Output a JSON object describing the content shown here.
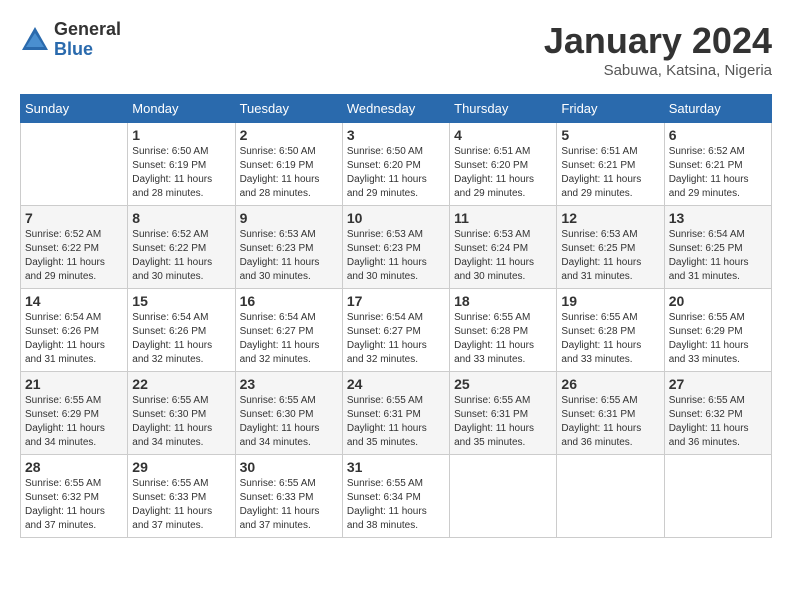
{
  "logo": {
    "general": "General",
    "blue": "Blue"
  },
  "header": {
    "month": "January 2024",
    "location": "Sabuwa, Katsina, Nigeria"
  },
  "weekdays": [
    "Sunday",
    "Monday",
    "Tuesday",
    "Wednesday",
    "Thursday",
    "Friday",
    "Saturday"
  ],
  "weeks": [
    [
      {
        "day": "",
        "info": ""
      },
      {
        "day": "1",
        "info": "Sunrise: 6:50 AM\nSunset: 6:19 PM\nDaylight: 11 hours\nand 28 minutes."
      },
      {
        "day": "2",
        "info": "Sunrise: 6:50 AM\nSunset: 6:19 PM\nDaylight: 11 hours\nand 28 minutes."
      },
      {
        "day": "3",
        "info": "Sunrise: 6:50 AM\nSunset: 6:20 PM\nDaylight: 11 hours\nand 29 minutes."
      },
      {
        "day": "4",
        "info": "Sunrise: 6:51 AM\nSunset: 6:20 PM\nDaylight: 11 hours\nand 29 minutes."
      },
      {
        "day": "5",
        "info": "Sunrise: 6:51 AM\nSunset: 6:21 PM\nDaylight: 11 hours\nand 29 minutes."
      },
      {
        "day": "6",
        "info": "Sunrise: 6:52 AM\nSunset: 6:21 PM\nDaylight: 11 hours\nand 29 minutes."
      }
    ],
    [
      {
        "day": "7",
        "info": "Sunrise: 6:52 AM\nSunset: 6:22 PM\nDaylight: 11 hours\nand 29 minutes."
      },
      {
        "day": "8",
        "info": "Sunrise: 6:52 AM\nSunset: 6:22 PM\nDaylight: 11 hours\nand 30 minutes."
      },
      {
        "day": "9",
        "info": "Sunrise: 6:53 AM\nSunset: 6:23 PM\nDaylight: 11 hours\nand 30 minutes."
      },
      {
        "day": "10",
        "info": "Sunrise: 6:53 AM\nSunset: 6:23 PM\nDaylight: 11 hours\nand 30 minutes."
      },
      {
        "day": "11",
        "info": "Sunrise: 6:53 AM\nSunset: 6:24 PM\nDaylight: 11 hours\nand 30 minutes."
      },
      {
        "day": "12",
        "info": "Sunrise: 6:53 AM\nSunset: 6:25 PM\nDaylight: 11 hours\nand 31 minutes."
      },
      {
        "day": "13",
        "info": "Sunrise: 6:54 AM\nSunset: 6:25 PM\nDaylight: 11 hours\nand 31 minutes."
      }
    ],
    [
      {
        "day": "14",
        "info": "Sunrise: 6:54 AM\nSunset: 6:26 PM\nDaylight: 11 hours\nand 31 minutes."
      },
      {
        "day": "15",
        "info": "Sunrise: 6:54 AM\nSunset: 6:26 PM\nDaylight: 11 hours\nand 32 minutes."
      },
      {
        "day": "16",
        "info": "Sunrise: 6:54 AM\nSunset: 6:27 PM\nDaylight: 11 hours\nand 32 minutes."
      },
      {
        "day": "17",
        "info": "Sunrise: 6:54 AM\nSunset: 6:27 PM\nDaylight: 11 hours\nand 32 minutes."
      },
      {
        "day": "18",
        "info": "Sunrise: 6:55 AM\nSunset: 6:28 PM\nDaylight: 11 hours\nand 33 minutes."
      },
      {
        "day": "19",
        "info": "Sunrise: 6:55 AM\nSunset: 6:28 PM\nDaylight: 11 hours\nand 33 minutes."
      },
      {
        "day": "20",
        "info": "Sunrise: 6:55 AM\nSunset: 6:29 PM\nDaylight: 11 hours\nand 33 minutes."
      }
    ],
    [
      {
        "day": "21",
        "info": "Sunrise: 6:55 AM\nSunset: 6:29 PM\nDaylight: 11 hours\nand 34 minutes."
      },
      {
        "day": "22",
        "info": "Sunrise: 6:55 AM\nSunset: 6:30 PM\nDaylight: 11 hours\nand 34 minutes."
      },
      {
        "day": "23",
        "info": "Sunrise: 6:55 AM\nSunset: 6:30 PM\nDaylight: 11 hours\nand 34 minutes."
      },
      {
        "day": "24",
        "info": "Sunrise: 6:55 AM\nSunset: 6:31 PM\nDaylight: 11 hours\nand 35 minutes."
      },
      {
        "day": "25",
        "info": "Sunrise: 6:55 AM\nSunset: 6:31 PM\nDaylight: 11 hours\nand 35 minutes."
      },
      {
        "day": "26",
        "info": "Sunrise: 6:55 AM\nSunset: 6:31 PM\nDaylight: 11 hours\nand 36 minutes."
      },
      {
        "day": "27",
        "info": "Sunrise: 6:55 AM\nSunset: 6:32 PM\nDaylight: 11 hours\nand 36 minutes."
      }
    ],
    [
      {
        "day": "28",
        "info": "Sunrise: 6:55 AM\nSunset: 6:32 PM\nDaylight: 11 hours\nand 37 minutes."
      },
      {
        "day": "29",
        "info": "Sunrise: 6:55 AM\nSunset: 6:33 PM\nDaylight: 11 hours\nand 37 minutes."
      },
      {
        "day": "30",
        "info": "Sunrise: 6:55 AM\nSunset: 6:33 PM\nDaylight: 11 hours\nand 37 minutes."
      },
      {
        "day": "31",
        "info": "Sunrise: 6:55 AM\nSunset: 6:34 PM\nDaylight: 11 hours\nand 38 minutes."
      },
      {
        "day": "",
        "info": ""
      },
      {
        "day": "",
        "info": ""
      },
      {
        "day": "",
        "info": ""
      }
    ]
  ]
}
